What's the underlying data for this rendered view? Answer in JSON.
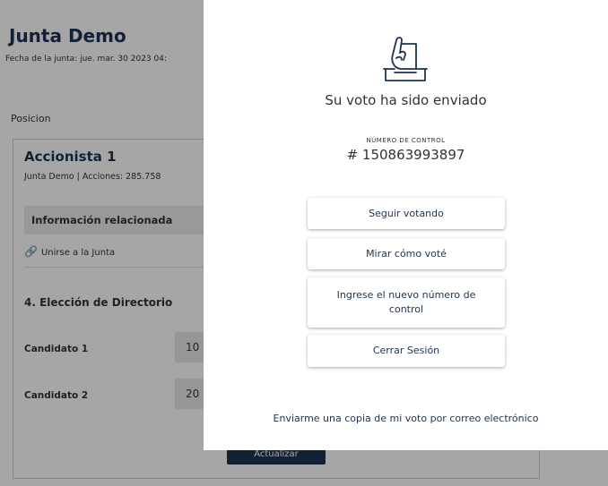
{
  "background": {
    "title": "Junta Demo",
    "date_text": "Fecha de la junta: jue. mar. 30 2023 04:",
    "posicion_label": "Posicion",
    "holder_name": "Accionista 1",
    "holder_sub": "Junta Demo | Acciones: 285.758",
    "info_label": "Información relacionada",
    "join_link": "Unirse a la Junta",
    "section_title": "4. Elección de Directorio",
    "candidates": [
      {
        "label": "Candidato 1",
        "value": "10"
      },
      {
        "label": "Candidato 2",
        "value": "20"
      }
    ],
    "submit_label": "Actualizar"
  },
  "modal": {
    "icon": "ballot-box-icon",
    "title": "Su voto ha sido enviado",
    "control_label": "NÚMERO DE CONTROL",
    "control_number": "# 150863993897",
    "buttons": {
      "continue": "Seguir votando",
      "view_vote": "Mirar cómo voté",
      "new_control": "Ingrese el nuevo número de control",
      "logout": "Cerrar Sesión"
    },
    "email_link": "Enviarme una copia de mi voto por correo electrónico"
  },
  "colors": {
    "brand": "#1d3350",
    "overlay": "rgba(0,0,0,0.35)"
  }
}
